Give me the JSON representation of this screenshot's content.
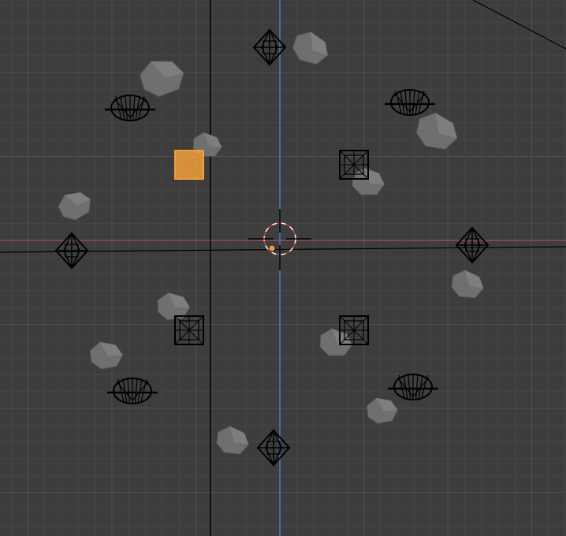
{
  "app": {
    "title": "",
    "view": "3D Viewport"
  },
  "colors": {
    "background": "#3d3d3d",
    "grid_minor": "#474747",
    "grid_major": "#505050",
    "x_axis": "#9a4a4a",
    "z_axis": "#4d7bc4",
    "wire": "#000000",
    "selected": "#f0a040",
    "rock": "#6f6f6f",
    "rock_light": "#858585",
    "cursor_ring_a": "#ffffff",
    "cursor_ring_b": "#d23c3c",
    "origin_dot": "#f09a3c"
  },
  "icons": {
    "diamond_empty": "octahedron-wire-icon",
    "cube_empty": "cube-wire-icon",
    "cylinder_empty": "cylinder-wire-icon",
    "rock": "rock-mesh-icon",
    "cursor": "3d-cursor-icon"
  },
  "objects": {
    "diamonds": [
      {
        "name": "empty-top"
      },
      {
        "name": "empty-left"
      },
      {
        "name": "empty-right"
      },
      {
        "name": "empty-bottom"
      }
    ],
    "cubes": [
      {
        "name": "cube-upper-right",
        "selected": false
      },
      {
        "name": "cube-upper-left",
        "selected": true
      },
      {
        "name": "cube-lower-left",
        "selected": false
      },
      {
        "name": "cube-lower-right",
        "selected": false
      }
    ],
    "cylinders": [
      {
        "name": "cylinder-upper-left"
      },
      {
        "name": "cylinder-upper-right"
      },
      {
        "name": "cylinder-lower-left"
      },
      {
        "name": "cylinder-lower-right"
      }
    ],
    "rocks": [
      {
        "name": "rock-1"
      },
      {
        "name": "rock-2"
      },
      {
        "name": "rock-3"
      },
      {
        "name": "rock-4"
      },
      {
        "name": "rock-5"
      },
      {
        "name": "rock-6"
      },
      {
        "name": "rock-7"
      },
      {
        "name": "rock-8"
      },
      {
        "name": "rock-9"
      },
      {
        "name": "rock-10"
      },
      {
        "name": "rock-11"
      },
      {
        "name": "rock-12"
      }
    ]
  }
}
